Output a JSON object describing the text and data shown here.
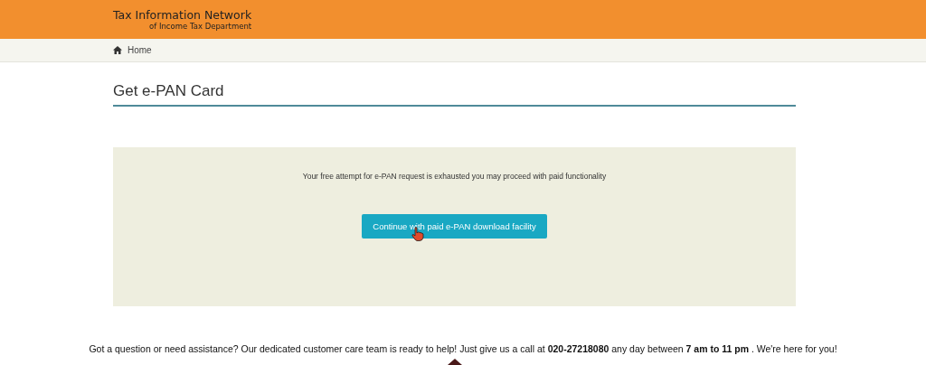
{
  "header": {
    "title": "Tax Information Network",
    "subtitle": "of Income Tax Department"
  },
  "breadcrumb": {
    "label": "Home"
  },
  "page_title": "Get e-PAN Card",
  "panel": {
    "message": "Your free attempt for e-PAN request is exhausted you may proceed with paid functionality",
    "button": "Continue with paid e-PAN download facility"
  },
  "footer": {
    "text": "Got a question or need assistance? Our dedicated customer care team is ready to help! Just give us a call at **020-27218080** any day between **7 am to 11 pm** . We're here for you!"
  }
}
